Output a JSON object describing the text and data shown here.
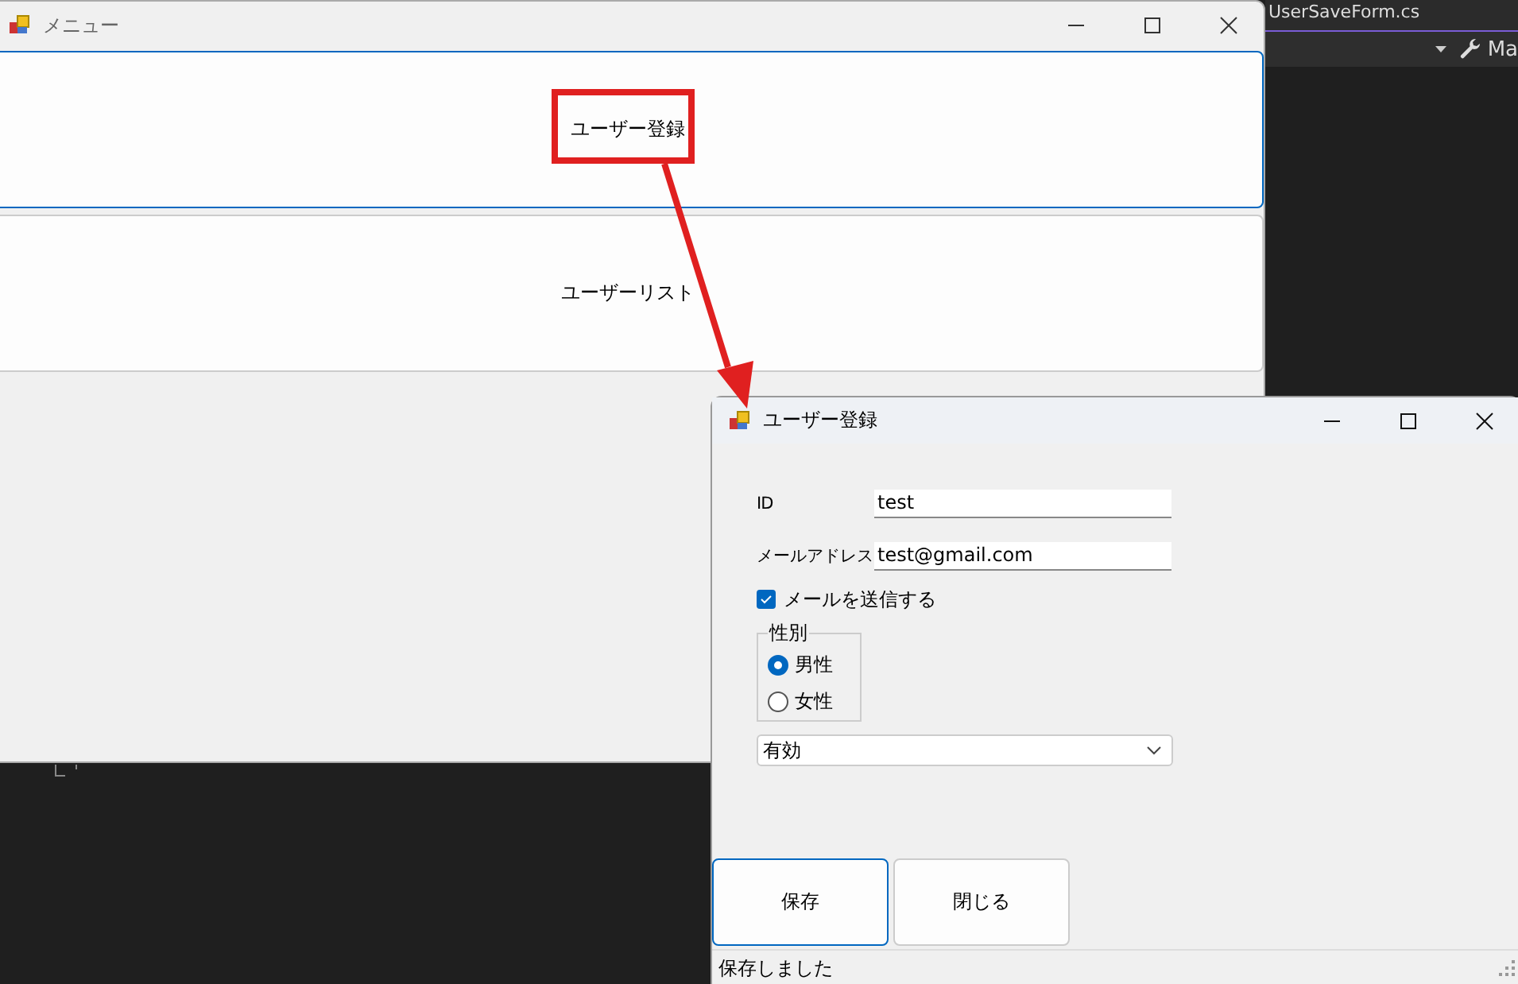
{
  "ide": {
    "tab": "UserSaveForm.cs",
    "toolbar_text": "Ma"
  },
  "menu_window": {
    "title": "メニュー",
    "buttons": [
      {
        "label": "ユーザー登録",
        "focused": true
      },
      {
        "label": "ユーザーリスト",
        "focused": false
      }
    ]
  },
  "annotation": {
    "kind": "highlight-arrow"
  },
  "dialog": {
    "title": "ユーザー登録",
    "fields": [
      {
        "label": "ID",
        "value": "test"
      },
      {
        "label": "メールアドレス",
        "value": "test@gmail.com"
      }
    ],
    "checkbox": {
      "label": "メールを送信する",
      "checked": true
    },
    "group": {
      "title": "性別",
      "options": [
        {
          "label": "男性",
          "selected": true
        },
        {
          "label": "女性",
          "selected": false
        }
      ]
    },
    "combo": {
      "value": "有効"
    },
    "buttons": [
      {
        "label": "保存",
        "focused": true
      },
      {
        "label": "閉じる",
        "focused": false
      }
    ],
    "status_bar": "保存しました"
  }
}
